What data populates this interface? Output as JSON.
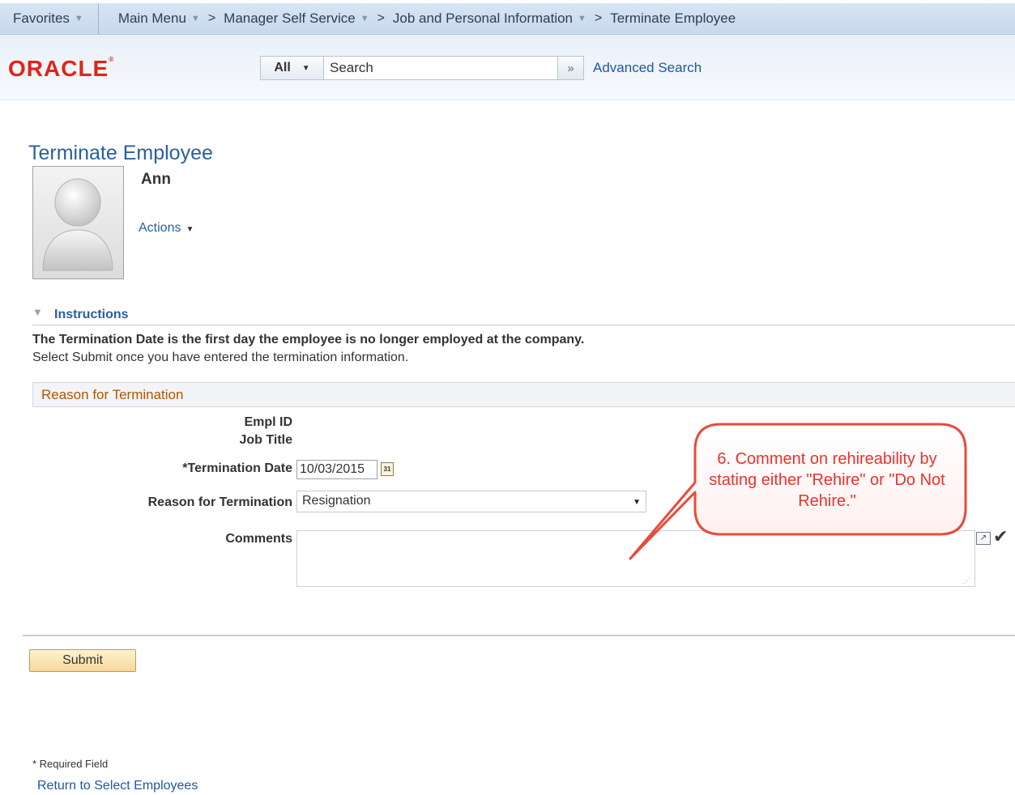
{
  "nav": {
    "favorites": "Favorites",
    "main_menu": "Main Menu",
    "manager_self_service": "Manager Self Service",
    "job_personal_info": "Job and Personal Information",
    "current": "Terminate Employee",
    "separator": ">"
  },
  "header": {
    "logo": "ORACLE",
    "search_scope": "All",
    "search_placeholder": "Search",
    "advanced_search": "Advanced Search"
  },
  "page": {
    "title": "Terminate Employee",
    "employee_name": "Ann",
    "actions_label": "Actions"
  },
  "instructions": {
    "title": "Instructions",
    "line1": "The Termination Date is the first day the employee is no longer employed at the company.",
    "line2": "Select Submit once you have entered the termination information."
  },
  "form": {
    "section_title": "Reason for Termination",
    "empl_id_label": "Empl ID",
    "job_title_label": "Job Title",
    "termination_date_label": "*Termination Date",
    "termination_date_value": "10/03/2015",
    "calendar_glyph": "31",
    "reason_label": "Reason for Termination",
    "reason_value": "Resignation",
    "comments_label": "Comments",
    "comments_value": ""
  },
  "callout": {
    "text": "6. Comment on rehireability by stating either \"Rehire\" or \"Do Not Rehire.\""
  },
  "footer": {
    "submit_label": "Submit",
    "required_note": "* Required Field",
    "return_link": "Return to Select Employees"
  },
  "colors": {
    "link_blue": "#2a5f9e",
    "section_orange": "#b35400",
    "oracle_red": "#e32219",
    "callout_red": "#e8332a"
  }
}
